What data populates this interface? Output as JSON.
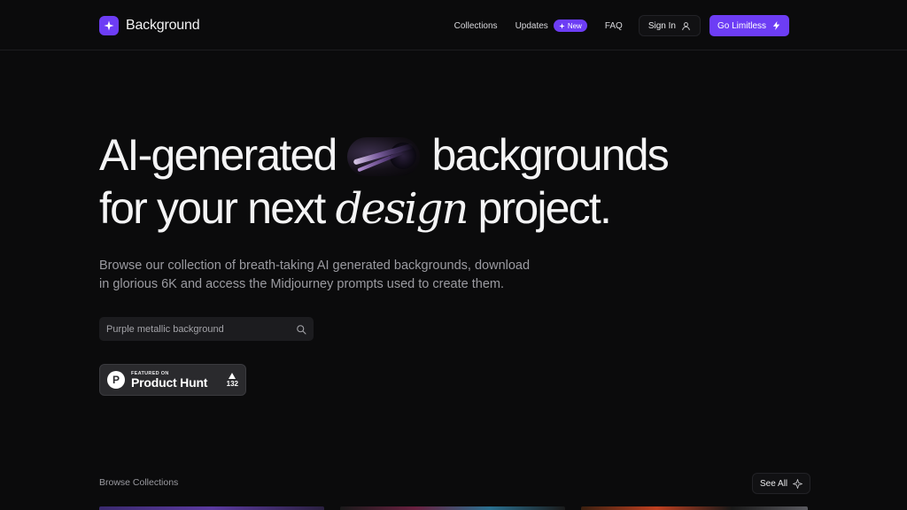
{
  "header": {
    "brand": "Background",
    "nav": {
      "collections": "Collections",
      "updates": "Updates",
      "new_badge": "New",
      "faq": "FAQ",
      "sign_in": "Sign In",
      "go_limitless": "Go Limitless"
    }
  },
  "hero": {
    "title_part1": "AI-generated",
    "title_part2": "backgrounds",
    "title_part3": "for your next",
    "title_italic": "design",
    "title_part4": "project.",
    "subtitle": "Browse our collection of breath-taking AI generated backgrounds, download in glorious 6K and access the Midjourney prompts used to create them."
  },
  "search": {
    "placeholder": "Purple metallic background",
    "icon": "search-icon"
  },
  "product_hunt": {
    "featured_on": "FEATURED ON",
    "name": "Product Hunt",
    "logo_letter": "P",
    "votes": "132"
  },
  "collections": {
    "label": "Browse Collections",
    "see_all": "See All"
  },
  "colors": {
    "accent": "#6d3df5",
    "background": "#0b0b0c",
    "muted_text": "#9b9ba1"
  }
}
